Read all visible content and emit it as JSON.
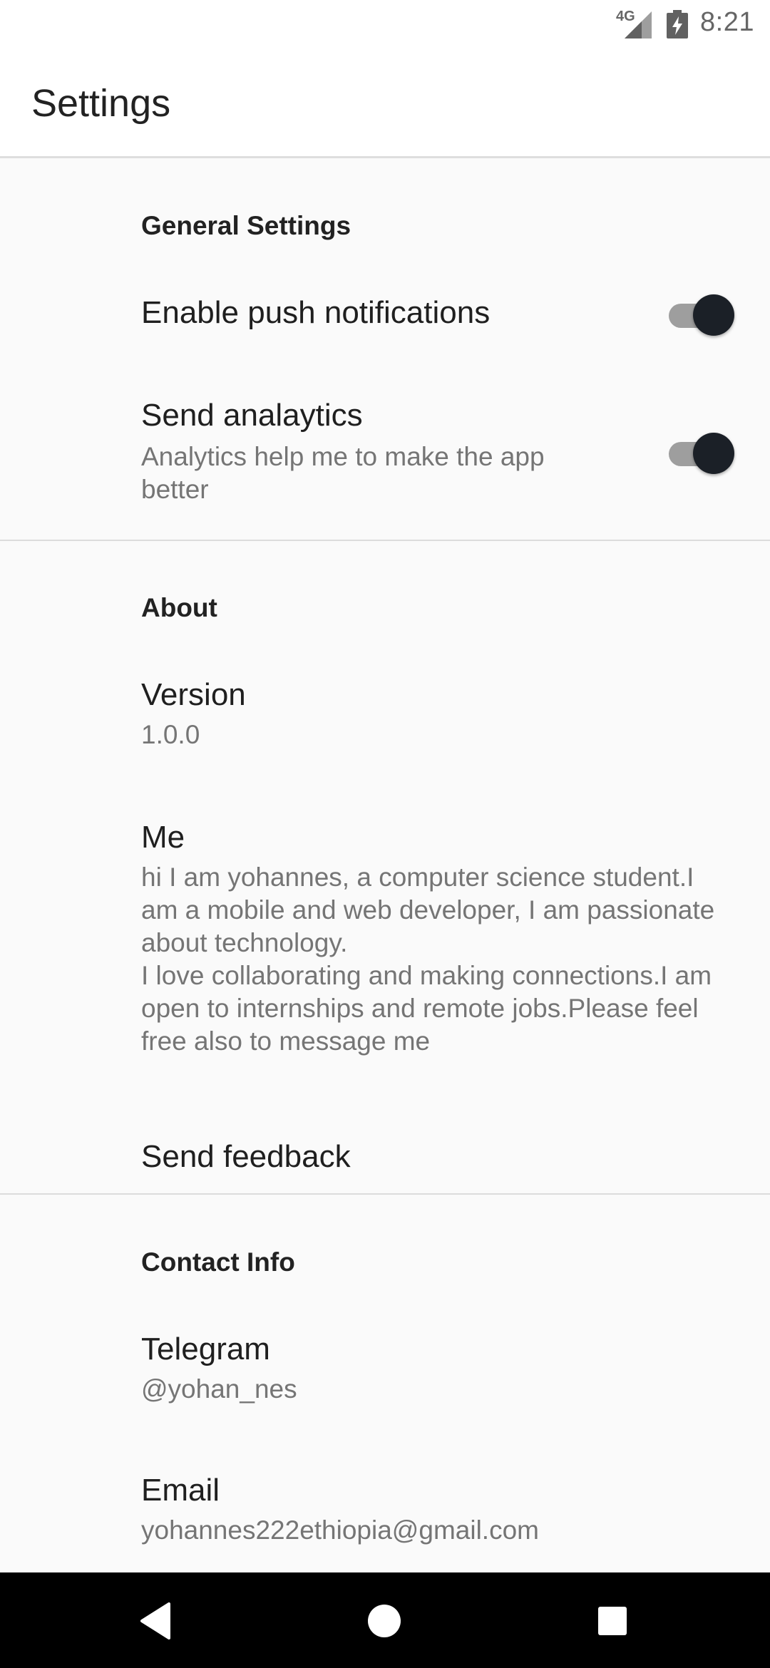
{
  "status_bar": {
    "network": "4G",
    "time": "8:21"
  },
  "app_bar": {
    "title": "Settings"
  },
  "sections": {
    "general": {
      "header": "General Settings",
      "push": {
        "title": "Enable push notifications",
        "enabled": true
      },
      "analytics": {
        "title": "Send analaytics",
        "summary": "Analytics help me to make the app better",
        "enabled": true
      }
    },
    "about": {
      "header": "About",
      "version": {
        "title": "Version",
        "summary": "1.0.0"
      },
      "me": {
        "title": "Me",
        "summary_line1": "hi I am yohannes, a computer science student.I am a mobile and web developer, I am passionate about technology.",
        "summary_line2": "I love collaborating and making connections.I am open to internships and remote jobs.Please feel free also to message me"
      },
      "feedback": {
        "title": "Send feedback"
      }
    },
    "contact": {
      "header": "Contact Info",
      "telegram": {
        "title": "Telegram",
        "summary": "@yohan_nes"
      },
      "email": {
        "title": "Email",
        "summary": "yohannes222ethiopia@gmail.com"
      }
    }
  },
  "colors": {
    "toggle_thumb": "#1b2027",
    "toggle_track": "#9e9e9e",
    "summary_text": "#757575",
    "nav_bar": "#000000"
  },
  "icons": {
    "signal": "signal-icon",
    "battery": "battery-charging-icon",
    "back": "back-icon",
    "home": "home-icon",
    "recents": "recents-icon"
  }
}
